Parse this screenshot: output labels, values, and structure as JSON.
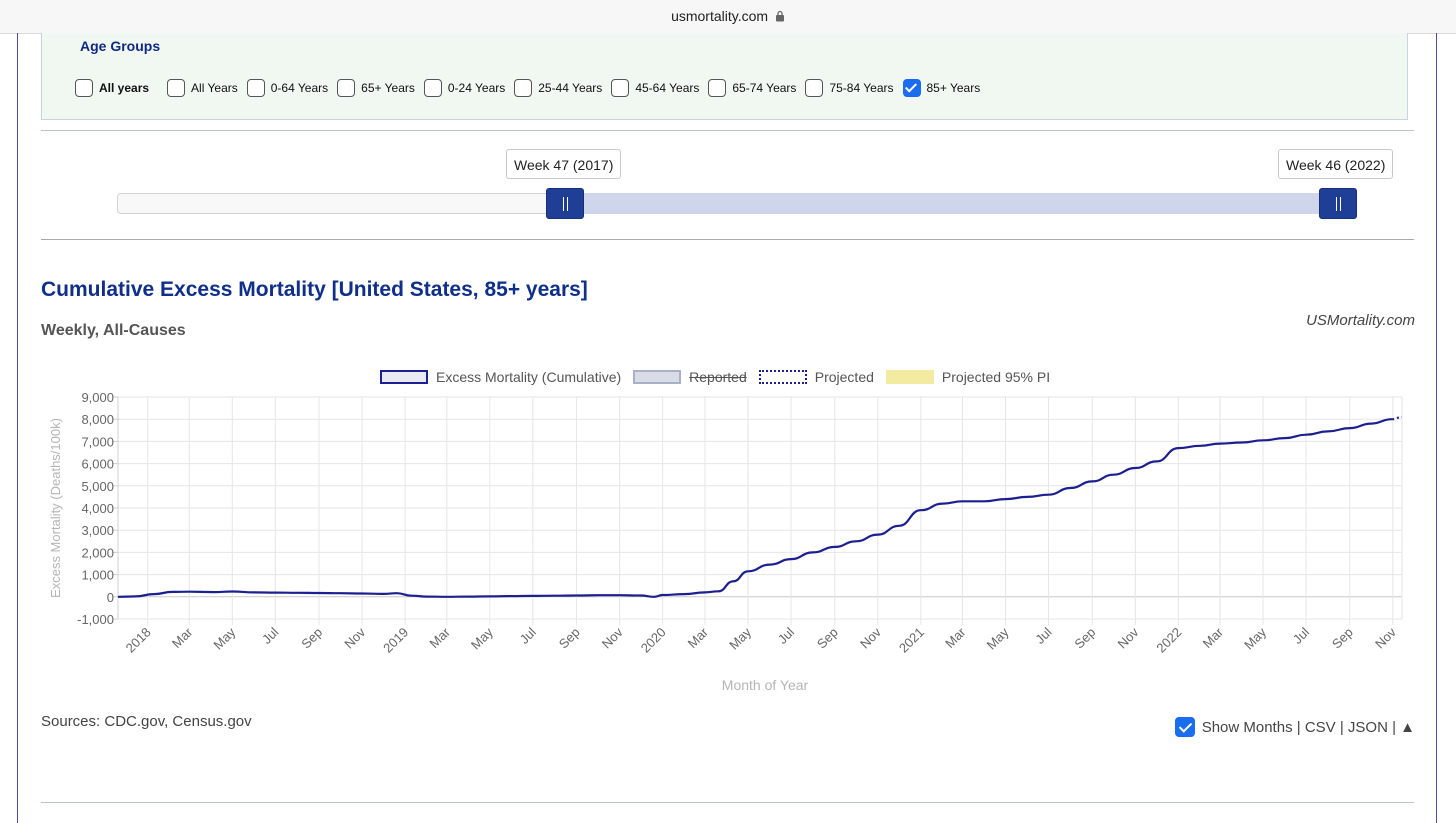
{
  "browser": {
    "url": "usmortality.com",
    "lock_icon": "lock-icon"
  },
  "age_groups": {
    "title": "Age Groups",
    "options": [
      {
        "label": "All years",
        "checked": false,
        "bold": true
      },
      {
        "label": "All Years",
        "checked": false
      },
      {
        "label": "0-64 Years",
        "checked": false
      },
      {
        "label": "65+ Years",
        "checked": false
      },
      {
        "label": "0-24 Years",
        "checked": false
      },
      {
        "label": "25-44 Years",
        "checked": false
      },
      {
        "label": "45-64 Years",
        "checked": false
      },
      {
        "label": "65-74 Years",
        "checked": false
      },
      {
        "label": "75-84 Years",
        "checked": false
      },
      {
        "label": "85+ Years",
        "checked": true
      }
    ]
  },
  "range_slider": {
    "start_label": "Week 47 (2017)",
    "end_label": "Week 46 (2022)",
    "start_fraction": 0.35,
    "end_fraction": 0.985
  },
  "chart_header": {
    "title": "Cumulative Excess Mortality [United States, 85+ years]",
    "subtitle": "Weekly, All-Causes",
    "brand": "USMortality.com"
  },
  "colors": {
    "series": "#1c1f8f",
    "title": "#0f2f8a",
    "accent": "#1f3f97",
    "reported": "#d9dbe6",
    "pi": "#f3eba2"
  },
  "chart_data": {
    "type": "line",
    "title": "",
    "xlabel": "Month of Year",
    "ylabel": "Excess Mortality (Deaths/100k)",
    "ylim": [
      -1000,
      9000
    ],
    "yticks": [
      9000,
      8000,
      7000,
      6000,
      5000,
      4000,
      3000,
      2000,
      1000,
      0,
      -1000
    ],
    "ytick_labels": [
      "9,000",
      "8,000",
      "7,000",
      "6,000",
      "5,000",
      "4,000",
      "3,000",
      "2,000",
      "1,000",
      "0",
      "-1,000"
    ],
    "xlim": [
      "2017-11-20",
      "2022-11-14"
    ],
    "xticks": [
      "2018-01-01",
      "2018-03-01",
      "2018-05-01",
      "2018-07-01",
      "2018-09-01",
      "2018-11-01",
      "2019-01-01",
      "2019-03-01",
      "2019-05-01",
      "2019-07-01",
      "2019-09-01",
      "2019-11-01",
      "2020-01-01",
      "2020-03-01",
      "2020-05-01",
      "2020-07-01",
      "2020-09-01",
      "2020-11-01",
      "2021-01-01",
      "2021-03-01",
      "2021-05-01",
      "2021-07-01",
      "2021-09-01",
      "2021-11-01",
      "2022-01-01",
      "2022-03-01",
      "2022-05-01",
      "2022-07-01",
      "2022-09-01",
      "2022-11-01"
    ],
    "xtick_labels": [
      "2018",
      "Mar",
      "May",
      "Jul",
      "Sep",
      "Nov",
      "2019",
      "Mar",
      "May",
      "Jul",
      "Sep",
      "Nov",
      "2020",
      "Mar",
      "May",
      "Jul",
      "Sep",
      "Nov",
      "2021",
      "Mar",
      "May",
      "Jul",
      "Sep",
      "Nov",
      "2022",
      "Mar",
      "May",
      "Jul",
      "Sep",
      "Nov"
    ],
    "grid": true,
    "legend_position": "top",
    "legend": [
      {
        "label": "Excess Mortality (Cumulative)",
        "style": "solid",
        "strikethrough": false
      },
      {
        "label": "Reported",
        "style": "fill",
        "strikethrough": true
      },
      {
        "label": "Projected",
        "style": "dotted",
        "strikethrough": false
      },
      {
        "label": "Projected 95% PI",
        "style": "band",
        "strikethrough": false
      }
    ],
    "series": [
      {
        "name": "Excess Mortality (Cumulative)",
        "x": [
          "2017-11-20",
          "2017-12-15",
          "2018-01-10",
          "2018-02-05",
          "2018-03-01",
          "2018-04-05",
          "2018-05-01",
          "2018-06-01",
          "2018-07-01",
          "2018-08-01",
          "2018-09-01",
          "2018-10-01",
          "2018-11-01",
          "2018-12-01",
          "2018-12-20",
          "2019-01-10",
          "2019-02-01",
          "2019-03-01",
          "2019-04-01",
          "2019-05-01",
          "2019-06-01",
          "2019-07-01",
          "2019-08-01",
          "2019-09-01",
          "2019-10-01",
          "2019-11-01",
          "2019-12-01",
          "2019-12-20",
          "2020-01-01",
          "2020-02-01",
          "2020-03-01",
          "2020-03-20",
          "2020-04-10",
          "2020-05-01",
          "2020-06-01",
          "2020-07-01",
          "2020-08-01",
          "2020-09-01",
          "2020-10-01",
          "2020-11-01",
          "2020-12-01",
          "2021-01-01",
          "2021-02-01",
          "2021-03-01",
          "2021-04-01",
          "2021-05-01",
          "2021-06-01",
          "2021-07-01",
          "2021-08-01",
          "2021-09-01",
          "2021-10-01",
          "2021-11-01",
          "2021-12-01",
          "2022-01-01",
          "2022-02-01",
          "2022-03-01",
          "2022-04-01",
          "2022-05-01",
          "2022-06-01",
          "2022-07-01",
          "2022-08-01",
          "2022-09-01",
          "2022-10-01",
          "2022-10-31"
        ],
        "values": [
          0,
          20,
          120,
          220,
          230,
          210,
          240,
          200,
          190,
          180,
          170,
          160,
          150,
          130,
          160,
          50,
          10,
          0,
          10,
          20,
          30,
          40,
          50,
          60,
          70,
          70,
          60,
          0,
          80,
          120,
          200,
          250,
          700,
          1150,
          1450,
          1700,
          2000,
          2250,
          2500,
          2800,
          3200,
          3900,
          4200,
          4300,
          4300,
          4400,
          4500,
          4600,
          4900,
          5200,
          5500,
          5800,
          6100,
          6700,
          6800,
          6900,
          6950,
          7050,
          7150,
          7300,
          7450,
          7600,
          7800,
          8000
        ]
      },
      {
        "name": "Projected",
        "x": [
          "2022-10-31",
          "2022-11-14"
        ],
        "values": [
          8000,
          8100
        ]
      }
    ]
  },
  "footer": {
    "sources": "Sources: CDC.gov, Census.gov",
    "show_months_label": "Show Months",
    "show_months_checked": true,
    "links": [
      "CSV",
      "JSON"
    ],
    "separator": " | ",
    "scroll_top_icon": "▲"
  }
}
